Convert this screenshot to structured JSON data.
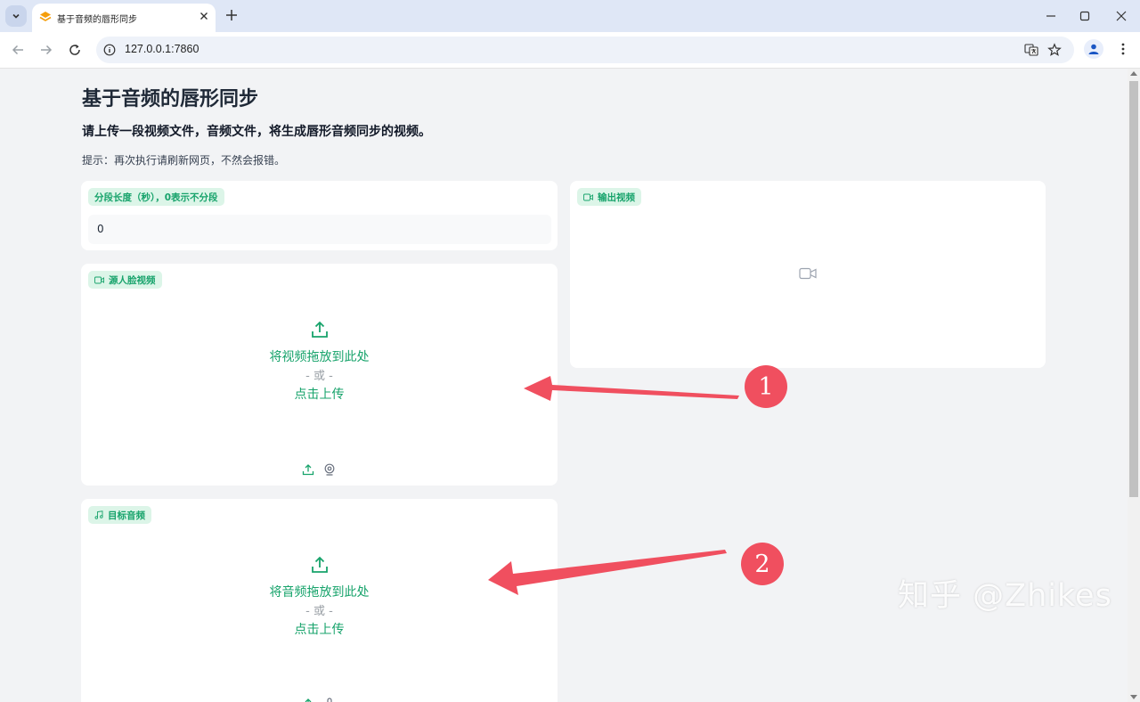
{
  "browser": {
    "tab_title": "基于音频的唇形同步",
    "url": "127.0.0.1:7860",
    "accent": "#dfe7f6"
  },
  "page": {
    "title": "基于音频的唇形同步",
    "subtitle": "请上传一段视频文件，音频文件，将生成唇形音频同步的视频。",
    "hint": "提示：再次执行请刷新网页，不然会报错。"
  },
  "segment": {
    "label": "分段长度（秒），0表示不分段",
    "value": "0"
  },
  "source_video": {
    "label": "源人脸视频",
    "icon": "video-camera-icon",
    "drop_text": "将视频拖放到此处",
    "or_text": "- 或 -",
    "click_text": "点击上传"
  },
  "target_audio": {
    "label": "目标音频",
    "icon": "music-note-icon",
    "drop_text": "将音频拖放到此处",
    "or_text": "- 或 -",
    "click_text": "点击上传"
  },
  "output_video": {
    "label": "输出视频",
    "icon": "video-camera-icon"
  },
  "annotations": {
    "marker_1": "1",
    "marker_2": "2",
    "color": "#f04f5f"
  },
  "watermark": "知乎 @Zhikes",
  "theme": {
    "accent_green": "#17a36b",
    "badge_bg": "#dcf5e8"
  }
}
